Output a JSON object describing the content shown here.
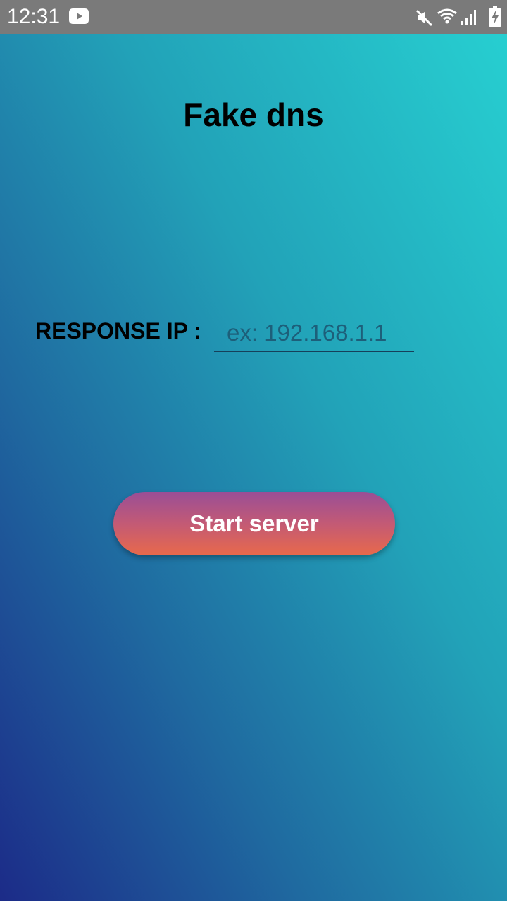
{
  "status_bar": {
    "time": "12:31",
    "icons": [
      "youtube-icon",
      "mute-icon",
      "wifi-icon",
      "signal-icon",
      "battery-charging-icon"
    ],
    "background": "#7a7a7a"
  },
  "app": {
    "title": "Fake dns",
    "response_ip_label": "RESPONSE IP :",
    "response_ip_value": "",
    "response_ip_placeholder": "ex: 192.168.1.1",
    "start_button_label": "Start server"
  },
  "colors": {
    "background_top": "#27d1d2",
    "background_bottom": "#1c2b88",
    "button_top": "#9a4e96",
    "button_bottom": "#e8694b",
    "text": "#000000"
  }
}
